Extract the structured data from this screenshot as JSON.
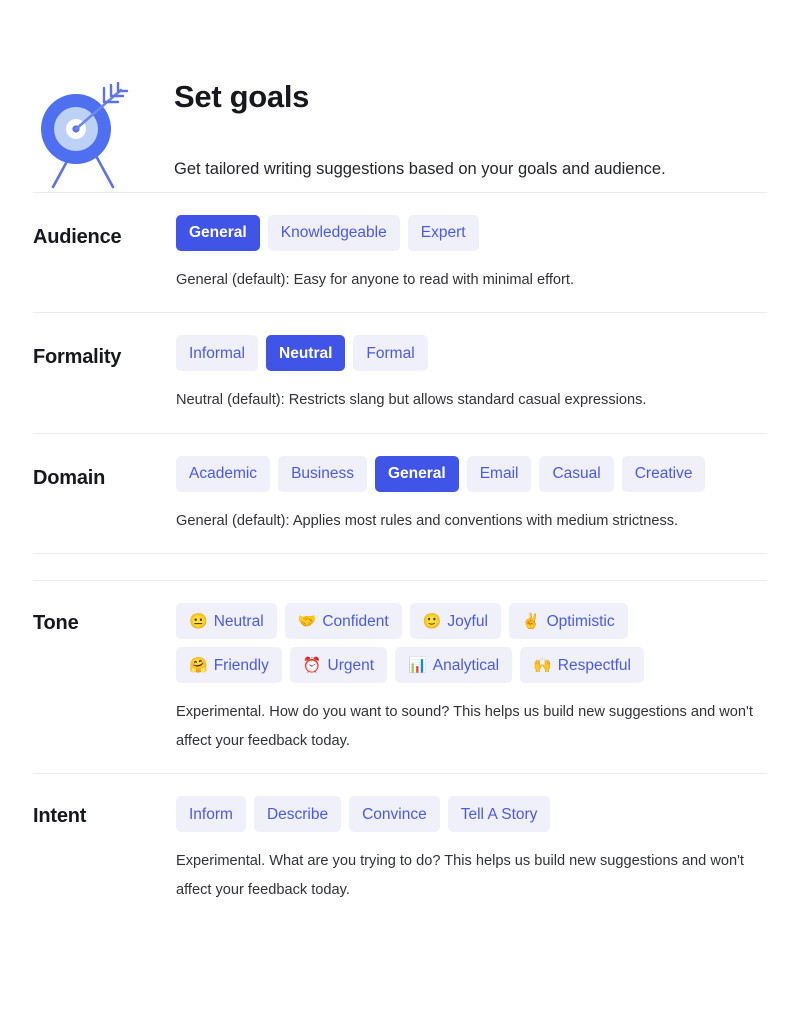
{
  "header": {
    "icon": "target-with-arrow-icon",
    "title": "Set goals",
    "subtitle": "Get tailored writing suggestions based on your goals and audience."
  },
  "colors": {
    "accent": "#4055e8",
    "chip_background": "#f0f0fa",
    "chip_text": "#4a5ae8",
    "divider": "#ececed",
    "heading_text": "#16181d"
  },
  "sections": [
    {
      "key": "audience",
      "label": "Audience",
      "options": [
        {
          "label": "General",
          "selected": true
        },
        {
          "label": "Knowledgeable",
          "selected": false
        },
        {
          "label": "Expert",
          "selected": false
        }
      ],
      "description": "General (default): Easy for anyone to read with minimal effort."
    },
    {
      "key": "formality",
      "label": "Formality",
      "options": [
        {
          "label": "Informal",
          "selected": false
        },
        {
          "label": "Neutral",
          "selected": true
        },
        {
          "label": "Formal",
          "selected": false
        }
      ],
      "description": "Neutral (default): Restricts slang but allows standard casual expressions."
    },
    {
      "key": "domain",
      "label": "Domain",
      "options": [
        {
          "label": "Academic",
          "selected": false
        },
        {
          "label": "Business",
          "selected": false
        },
        {
          "label": "General",
          "selected": true
        },
        {
          "label": "Email",
          "selected": false
        },
        {
          "label": "Casual",
          "selected": false
        },
        {
          "label": "Creative",
          "selected": false
        }
      ],
      "description": "General (default): Applies most rules and conventions with medium strictness."
    },
    {
      "key": "tone",
      "label": "Tone",
      "options": [
        {
          "label": "Neutral",
          "selected": false,
          "emoji": "😐",
          "icon": "neutral-face-emoji"
        },
        {
          "label": "Confident",
          "selected": false,
          "emoji": "🤝",
          "icon": "handshake-emoji"
        },
        {
          "label": "Joyful",
          "selected": false,
          "emoji": "🙂",
          "icon": "slightly-smiling-face-emoji"
        },
        {
          "label": "Optimistic",
          "selected": false,
          "emoji": "✌️",
          "icon": "victory-hand-emoji"
        },
        {
          "label": "Friendly",
          "selected": false,
          "emoji": "🤗",
          "icon": "hugging-face-emoji"
        },
        {
          "label": "Urgent",
          "selected": false,
          "emoji": "⏰",
          "icon": "alarm-clock-emoji"
        },
        {
          "label": "Analytical",
          "selected": false,
          "emoji": "📊",
          "icon": "bar-chart-emoji"
        },
        {
          "label": "Respectful",
          "selected": false,
          "emoji": "🙌",
          "icon": "raising-hands-emoji"
        }
      ],
      "description": "Experimental. How do you want to sound? This helps us build new suggestions and won't affect your feedback today."
    },
    {
      "key": "intent",
      "label": "Intent",
      "options": [
        {
          "label": "Inform",
          "selected": false
        },
        {
          "label": "Describe",
          "selected": false
        },
        {
          "label": "Convince",
          "selected": false
        },
        {
          "label": "Tell A Story",
          "selected": false
        }
      ],
      "description": "Experimental. What are you trying to do? This helps us build new suggestions and won't affect your feedback today."
    }
  ]
}
